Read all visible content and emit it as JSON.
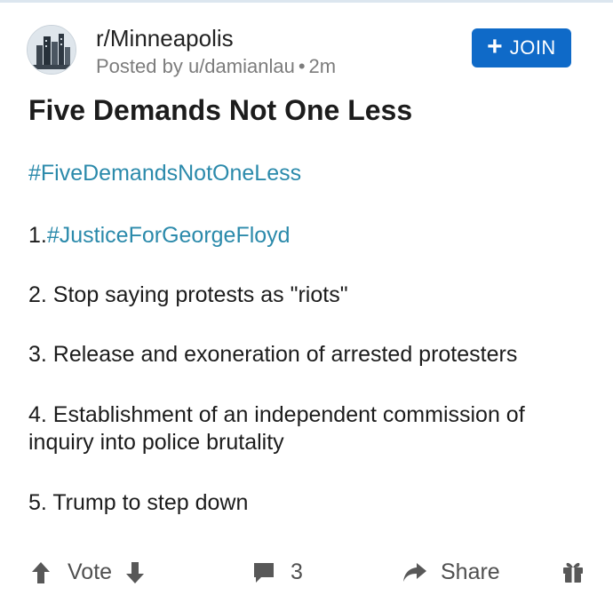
{
  "header": {
    "subreddit": "r/Minneapolis",
    "posted_by": "Posted by u/damianlau",
    "separator": "•",
    "age": "2m",
    "join_label": "JOIN",
    "join_color": "#0f6ac8"
  },
  "post": {
    "title": "Five Demands Not One Less",
    "hashtag": "#FiveDemandsNotOneLess",
    "demands": [
      {
        "prefix": "1.",
        "text": "#JusticeForGeorgeFloyd"
      },
      {
        "text": "2. Stop saying protests as \"riots\""
      },
      {
        "text": "3. Release and exoneration of arrested protesters"
      },
      {
        "text": "4. Establishment of an independent commission of inquiry into police brutality"
      },
      {
        "text": "5. Trump to step down"
      }
    ],
    "hashtag_color": "#2b8aab"
  },
  "actions": {
    "vote_label": "Vote",
    "comment_count": "3",
    "share_label": "Share"
  },
  "icons": [
    "subreddit-avatar",
    "plus-icon",
    "upvote-arrow-icon",
    "downvote-arrow-icon",
    "comment-icon",
    "share-arrow-icon",
    "award-gift-icon"
  ]
}
